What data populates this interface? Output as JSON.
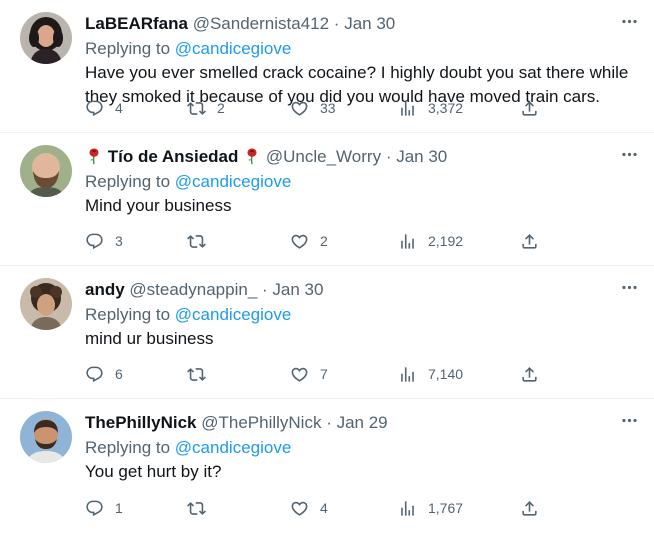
{
  "replying_to_label": "Replying to",
  "colors": {
    "link": "#1d9bf0",
    "muted": "#536471",
    "text": "#0f1419",
    "divider": "#eff3f4"
  },
  "tweets": [
    {
      "display_name": "LaBEARfana",
      "handle": "@Sandernista412",
      "separator": "·",
      "date": "Jan 30",
      "mention": "@candicegiove",
      "text": "Have you ever smelled crack cocaine?  I highly doubt you sat there while they smoked it because of you did you would have moved train cars.",
      "replies": "4",
      "retweets": "2",
      "likes": "33",
      "views": "3,372",
      "avatar_desc": "woman with dark curly hair"
    },
    {
      "display_name": "Tío de Ansiedad",
      "name_icons": [
        "rose-icon",
        "rose-icon"
      ],
      "handle": "@Uncle_Worry",
      "separator": "·",
      "date": "Jan 30",
      "mention": "@candicegiove",
      "text": "Mind your business",
      "replies": "3",
      "retweets": "",
      "likes": "2",
      "views": "2,192",
      "avatar_desc": "bearded bald man"
    },
    {
      "display_name": "andy",
      "handle": "@steadynappin_",
      "separator": "·",
      "date": "Jan 30",
      "mention": "@candicegiove",
      "text": "mind ur business",
      "replies": "6",
      "retweets": "",
      "likes": "7",
      "views": "7,140",
      "avatar_desc": "person with curly hair"
    },
    {
      "display_name": "ThePhillyNick",
      "handle": "@ThePhillyNick",
      "separator": "·",
      "date": "Jan 29",
      "mention": "@candicegiove",
      "text": "You get hurt by it?",
      "replies": "1",
      "retweets": "",
      "likes": "4",
      "views": "1,767",
      "avatar_desc": "smiling man with beard"
    }
  ]
}
